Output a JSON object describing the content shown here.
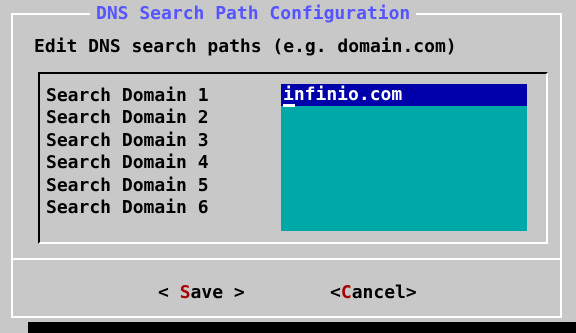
{
  "dialog": {
    "title": "DNS Search Path Configuration",
    "subtitle": "Edit DNS search paths (e.g. domain.com)"
  },
  "fields": [
    {
      "label": "Search Domain 1",
      "value": "infinio.com",
      "active": true
    },
    {
      "label": "Search Domain 2",
      "value": ""
    },
    {
      "label": "Search Domain 3",
      "value": ""
    },
    {
      "label": "Search Domain 4",
      "value": ""
    },
    {
      "label": "Search Domain 5",
      "value": ""
    },
    {
      "label": "Search Domain 6",
      "value": ""
    }
  ],
  "buttons": {
    "save": {
      "pre": "< ",
      "hotkey": "S",
      "rest": "ave >"
    },
    "cancel": {
      "pre": "<",
      "hotkey": "C",
      "rest": "ancel>"
    }
  },
  "colors": {
    "screen_bg": "#0000aa",
    "dialog_bg": "#c8c8c8",
    "title_fg": "#5555ff",
    "field_bg": "#00a8a8",
    "field_active_bg": "#0000aa",
    "hotkey_fg": "#aa0000"
  }
}
